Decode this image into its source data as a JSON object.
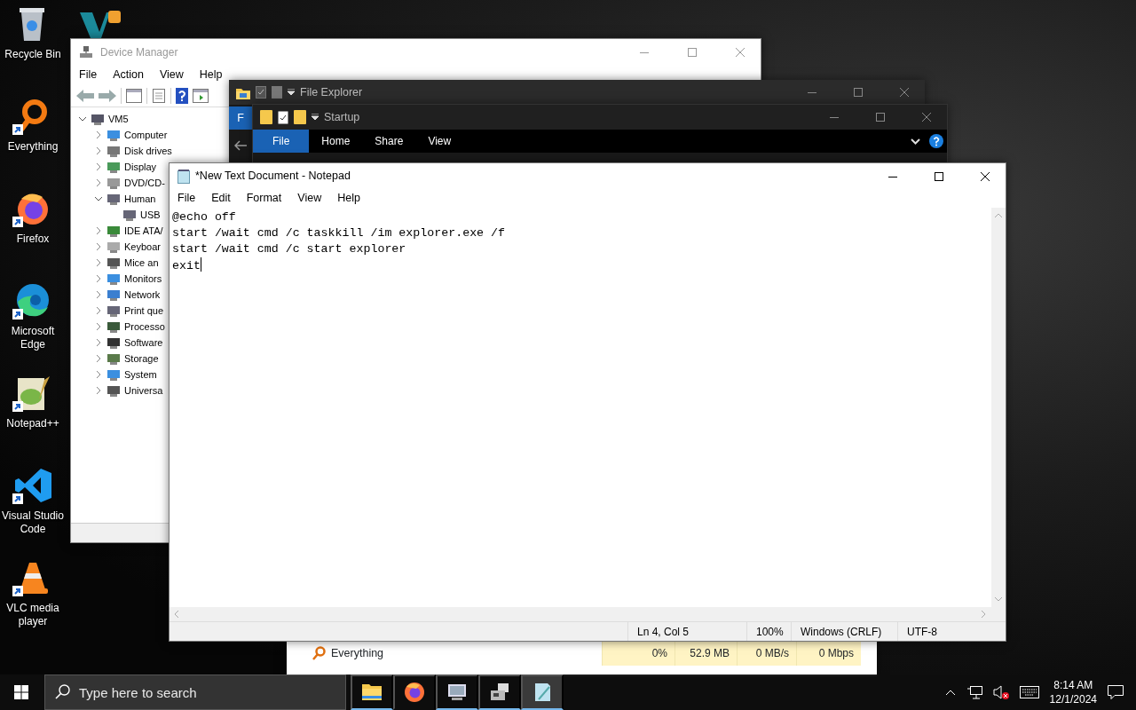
{
  "desktop_icons": [
    {
      "kind": "recycle_bin",
      "label": "Recycle Bin",
      "shortcut": false
    },
    {
      "kind": "everything",
      "label": "Everything",
      "shortcut": true
    },
    {
      "kind": "firefox",
      "label": "Firefox",
      "shortcut": true
    },
    {
      "kind": "edge",
      "label": "Microsoft Edge",
      "shortcut": true
    },
    {
      "kind": "notepadpp",
      "label": "Notepad++",
      "shortcut": true
    },
    {
      "kind": "vscode",
      "label": "Visual Studio Code",
      "shortcut": true
    },
    {
      "kind": "vlc",
      "label": "VLC media player",
      "shortcut": true
    }
  ],
  "device_manager": {
    "title": "Device Manager",
    "menu": [
      "File",
      "Action",
      "View",
      "Help"
    ],
    "tree": {
      "label": "VM5",
      "kind": "computer",
      "expanded": true,
      "children": [
        {
          "label": "Computer",
          "kind": "monitor",
          "expanded": false
        },
        {
          "label": "Disk drives",
          "kind": "disk",
          "expanded": false
        },
        {
          "label": "Display",
          "kind": "display",
          "expanded": false
        },
        {
          "label": "DVD/CD-",
          "kind": "dvd",
          "expanded": false
        },
        {
          "label": "Human",
          "kind": "hid",
          "expanded": true,
          "children": [
            {
              "label": "USB",
              "kind": "hid"
            }
          ]
        },
        {
          "label": "IDE ATA/",
          "kind": "ide",
          "expanded": false
        },
        {
          "label": "Keyboar",
          "kind": "keyboard",
          "expanded": false
        },
        {
          "label": "Mice an",
          "kind": "mouse",
          "expanded": false
        },
        {
          "label": "Monitors",
          "kind": "monitor",
          "expanded": false
        },
        {
          "label": "Network",
          "kind": "network",
          "expanded": false
        },
        {
          "label": "Print que",
          "kind": "printer",
          "expanded": false
        },
        {
          "label": "Processo",
          "kind": "processor",
          "expanded": false
        },
        {
          "label": "Software",
          "kind": "software",
          "expanded": false
        },
        {
          "label": "Storage",
          "kind": "storage",
          "expanded": false
        },
        {
          "label": "System",
          "kind": "system",
          "expanded": false
        },
        {
          "label": "Universa",
          "kind": "usb",
          "expanded": false
        }
      ]
    }
  },
  "file_explorer": {
    "title": "File Explorer",
    "ribbon_tab": "F"
  },
  "startup_window": {
    "title": "Startup",
    "ribbon_tabs": [
      {
        "label": "File",
        "selected": true
      },
      {
        "label": "Home",
        "selected": false
      },
      {
        "label": "Share",
        "selected": false
      },
      {
        "label": "View",
        "selected": false
      }
    ]
  },
  "notepad": {
    "title": "*New Text Document - Notepad",
    "menu": [
      "File",
      "Edit",
      "Format",
      "View",
      "Help"
    ],
    "lines": [
      "@echo off",
      "start /wait cmd /c taskkill /im explorer.exe /f",
      "start /wait cmd /c start explorer",
      "exit"
    ],
    "status_bar": {
      "position": "Ln 4, Col 5",
      "zoom": "100%",
      "line_ending": "Windows (CRLF)",
      "encoding": "UTF-8"
    }
  },
  "task_manager": {
    "rows": [
      {
        "name": "Everything",
        "cells": [
          "0%",
          "52.9 MB",
          "0 MB/s",
          "0 Mbps"
        ]
      }
    ]
  },
  "taskbar": {
    "search": {
      "placeholder": "Type here to search"
    },
    "apps": [
      {
        "kind": "file_explorer",
        "running": true,
        "selected": false
      },
      {
        "kind": "firefox",
        "running": false,
        "selected": false
      },
      {
        "kind": "device_manager",
        "running": true,
        "selected": false
      },
      {
        "kind": "devices",
        "running": true,
        "selected": false
      },
      {
        "kind": "notepad",
        "running": true,
        "selected": true
      }
    ],
    "volume_muted": true,
    "time": "8:14 AM",
    "date": "12/1/2024"
  }
}
